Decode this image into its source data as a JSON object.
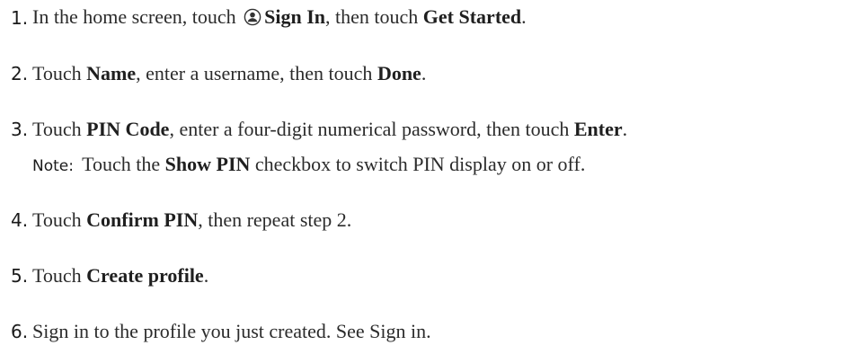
{
  "steps": [
    {
      "number": "1.",
      "text_a": "In the home screen, touch ",
      "icon": "user-circle-icon",
      "bold_a": "Sign In",
      "text_b": ", then touch ",
      "bold_b": "Get Started",
      "text_c": "."
    },
    {
      "number": "2.",
      "text_a": "Touch ",
      "bold_a": "Name",
      "text_b": ", enter a username, then touch ",
      "bold_b": "Done",
      "text_c": "."
    },
    {
      "number": "3.",
      "text_a": "Touch ",
      "bold_a": "PIN Code",
      "text_b": ", enter a four-digit numerical password, then touch ",
      "bold_b": "Enter",
      "text_c": "."
    },
    {
      "number": "4.",
      "text_a": "Touch ",
      "bold_a": "Confirm PIN",
      "text_b": ", then repeat step 2."
    },
    {
      "number": "5.",
      "text_a": "Touch ",
      "bold_a": "Create profile",
      "text_b": "."
    },
    {
      "number": "6.",
      "text_a": "Sign in to the profile you just created. See Sign in."
    }
  ],
  "note": {
    "label": "Note:",
    "text_a": " Touch the ",
    "bold_a": "Show PIN",
    "text_b": " checkbox to switch PIN display on or off."
  }
}
